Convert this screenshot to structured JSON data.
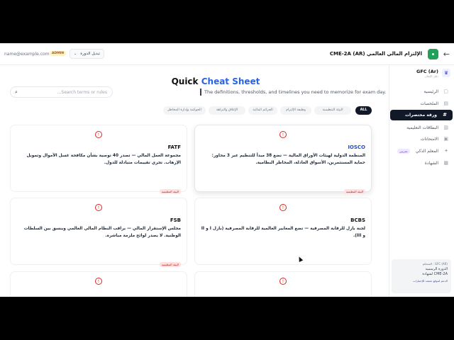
{
  "topbar": {
    "back_icon": "arrow-left-icon",
    "course_title": "الإلتزام المالي العالمي CME-2A (AR)",
    "email": "name@example.com",
    "role_badge": "ADMIN",
    "switch_label": "تبديل الدورة"
  },
  "sidebar": {
    "brand_title": "GFC (Ar)",
    "brand_subtitle": "دليل الإتقان",
    "items": [
      {
        "label": "الرئيسية",
        "icon": "home-icon"
      },
      {
        "label": "الملخصات",
        "icon": "book-icon"
      },
      {
        "label": "ورقة مختصرات",
        "icon": "hash-icon",
        "active": true
      },
      {
        "label": "البطاقات التعليمية",
        "icon": "cards-icon"
      },
      {
        "label": "الامتحانات",
        "icon": "exam-icon"
      },
      {
        "label": "المعلم الذكي",
        "icon": "sparkle-icon",
        "badge": "تجريبي"
      },
      {
        "label": "الشهادة",
        "icon": "certificate-icon"
      }
    ],
    "footer": {
      "line1": "المتحكم : GFC (AR)",
      "line2": "الدورة الرسمية",
      "line3": "لشهادة CME-2A",
      "link": "الدعم لموقع معتمد للإختبارات"
    }
  },
  "main": {
    "title_a": "Quick",
    "title_b": "Cheat Sheet",
    "subtitle": "The definitions, thresholds, and timelines you need to memorize for exam day.",
    "search_placeholder": "Search terms or rules...",
    "chips": [
      "ALL",
      "البيئة التنظيمية",
      "وظيفة الإلتزام",
      "الجرائم المالية",
      "الإغلاق والنزاهة",
      "الحوكمة وإدارة المخاطر"
    ],
    "cards": [
      {
        "title": "IOSCO",
        "desc": "المنظمة الدولية لهيئات الأوراق المالية — تضع 38 مبدأ للتنظيم عبر 3 محاور: حماية المستثمرين، الأسواق العادلة، المخاطر النظامية.",
        "tag": "البيئة التنظيمية"
      },
      {
        "title": "FATF",
        "desc": "مجموعة العمل المالي — تصدر 40 توصية بشأن مكافحة غسل الأموال وتمويل الإرهاب. تجري تقييمات متبادلة للدول.",
        "tag": "البيئة التنظيمية"
      },
      {
        "title": "BCBS",
        "desc": "لجنة بازل للرقابة المصرفية — تضع المعايير العالمية للرقابة المصرفية (بازل I و II و III).",
        "tag": "البيئة التنظيمية"
      },
      {
        "title": "FSB",
        "desc": "مجلس الإستقرار المالي — يراقب النظام المالي العالمي وينسق بين السلطات الوطنية. لا يصدر لوائح ملزمة مباشرة.",
        "tag": "البيئة التنظيمية"
      }
    ]
  }
}
